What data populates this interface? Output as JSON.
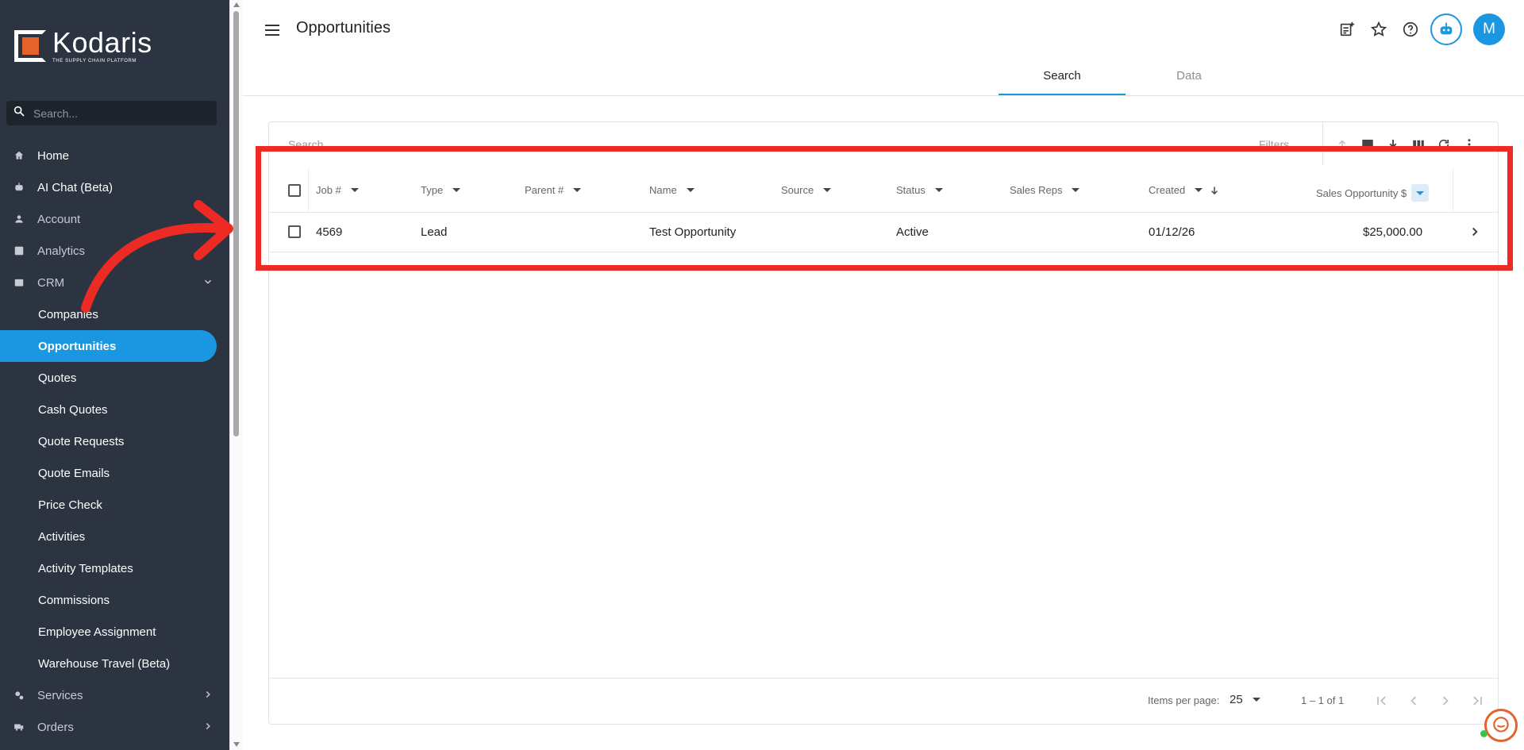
{
  "brand": {
    "name": "Kodaris",
    "tagline": "THE SUPPLY CHAIN PLATFORM",
    "accent": "#1b96e0",
    "logo_color": "#e4622c"
  },
  "sidebar": {
    "search_placeholder": "Search...",
    "items": [
      {
        "label": "Home",
        "icon": "home-icon"
      },
      {
        "label": "AI Chat (Beta)",
        "icon": "robot-icon"
      },
      {
        "label": "Account",
        "icon": "person-icon"
      },
      {
        "label": "Analytics",
        "icon": "analytics-icon"
      },
      {
        "label": "CRM",
        "icon": "crm-icon",
        "expanded": true
      }
    ],
    "crm_children": [
      "Companies",
      "Opportunities",
      "Quotes",
      "Cash Quotes",
      "Quote Requests",
      "Quote Emails",
      "Price Check",
      "Activities",
      "Activity Templates",
      "Commissions",
      "Employee Assignment",
      "Warehouse Travel (Beta)"
    ],
    "active_item": "Opportunities",
    "bottom_items": [
      {
        "label": "Services",
        "icon": "gears-icon"
      },
      {
        "label": "Orders",
        "icon": "truck-icon"
      }
    ]
  },
  "header": {
    "title": "Opportunities",
    "avatar_initial": "M",
    "tabs": [
      {
        "label": "Search",
        "active": true
      },
      {
        "label": "Data",
        "active": false
      }
    ]
  },
  "grid": {
    "search_placeholder": "Search",
    "filters_label": "Filters",
    "columns": [
      "Job #",
      "Type",
      "Parent #",
      "Name",
      "Source",
      "Status",
      "Sales Reps",
      "Created",
      "Sales Opportunity $"
    ],
    "rows": [
      {
        "job": "4569",
        "type": "Lead",
        "parent": "",
        "name": "Test Opportunity",
        "source": "",
        "status": "Active",
        "sales_reps": "",
        "created": "01/12/26",
        "amount": "$25,000.00"
      }
    ],
    "footer": {
      "items_per_page_label": "Items per page:",
      "page_size": "25",
      "range": "1 – 1 of 1"
    }
  },
  "annotation": {
    "highlight_color": "#ee2a24"
  }
}
